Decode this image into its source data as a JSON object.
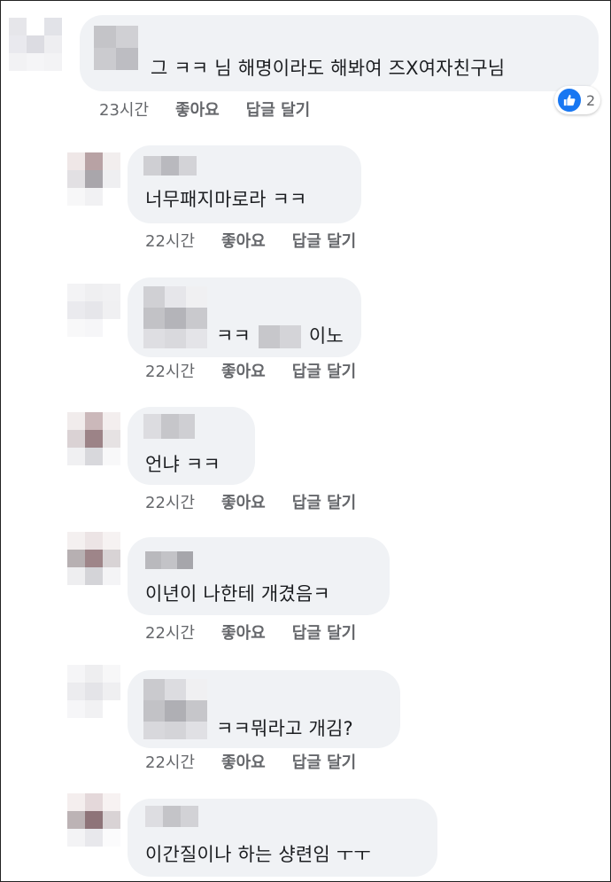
{
  "comments": [
    {
      "text_before": "",
      "text": "그 ㅋㅋ 님 해명이라도 해봐여 즈X여자친구님",
      "time": "23시간",
      "like_label": "좋아요",
      "reply_label": "답글 달기",
      "reactions": {
        "type": "like-icon",
        "count": "2"
      }
    },
    {
      "text": "너무패지마로라 ㅋㅋ",
      "time": "22시간",
      "like_label": "좋아요",
      "reply_label": "답글 달기"
    },
    {
      "text_before": "ㅋㅋ",
      "text_after": "이노",
      "time": "22시간",
      "like_label": "좋아요",
      "reply_label": "답글 달기"
    },
    {
      "text": "언냐 ㅋㅋ",
      "time": "22시간",
      "like_label": "좋아요",
      "reply_label": "답글 달기"
    },
    {
      "text": "이년이 나한테 개겼음ㅋ",
      "time": "22시간",
      "like_label": "좋아요",
      "reply_label": "답글 달기"
    },
    {
      "text": "ㅋㅋ뭐라고 개김?",
      "time": "22시간",
      "like_label": "좋아요",
      "reply_label": "답글 달기"
    },
    {
      "text": "이간질이나 하는 샹련임 ㅜㅜ"
    }
  ],
  "colors": {
    "bubble": "#f0f2f5",
    "text": "#1c1e21",
    "meta": "#65676b",
    "like_badge": "#1877f2"
  }
}
